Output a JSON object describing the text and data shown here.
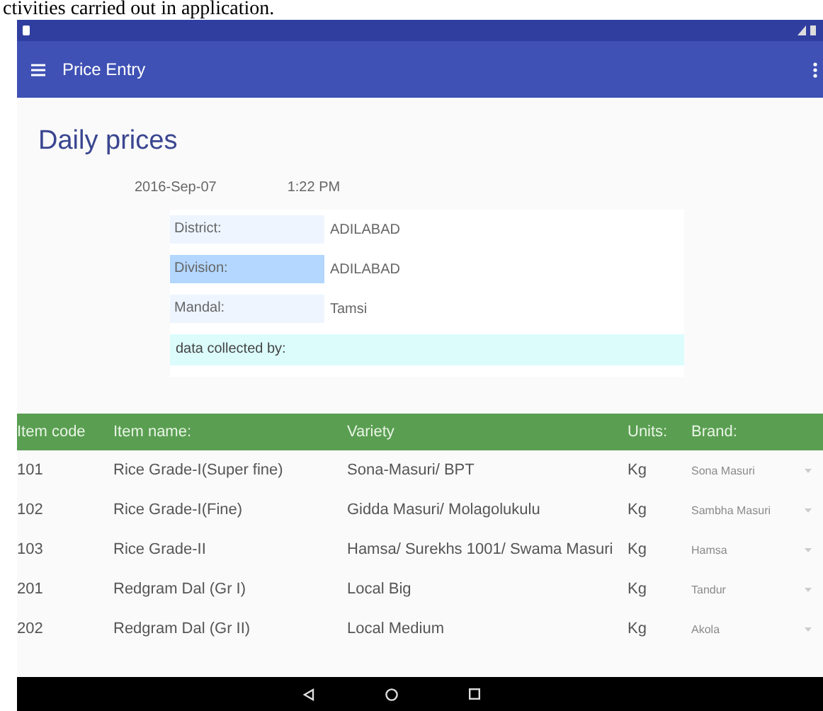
{
  "caption": "ctivities carried out in application.",
  "app_bar": {
    "title": "Price Entry"
  },
  "heading": "Daily prices",
  "date": "2016-Sep-07",
  "time": "1:22 PM",
  "form": [
    {
      "label": "District:",
      "value": "ADILABAD",
      "selected": false
    },
    {
      "label": "Division:",
      "value": "ADILABAD",
      "selected": true
    },
    {
      "label": "Mandal:",
      "value": "Tamsi",
      "selected": false
    }
  ],
  "collected_by": {
    "label": "data collected by:"
  },
  "table": {
    "columns": [
      "Item code",
      "Item name:",
      "Variety",
      "Units:",
      "Brand:"
    ],
    "rows": [
      {
        "code": "101",
        "name": "Rice Grade-I(Super fine)",
        "variety": "Sona-Masuri/ BPT",
        "units": "Kg",
        "brand_placeholder": "Sona Masuri"
      },
      {
        "code": "102",
        "name": "Rice Grade-I(Fine)",
        "variety": "Gidda Masuri/ Molagolukulu",
        "units": "Kg",
        "brand_placeholder": "Sambha Masuri"
      },
      {
        "code": "103",
        "name": "Rice Grade-II",
        "variety": "Hamsa/ Surekhs 1001/ Swama Masuri",
        "units": "Kg",
        "brand_placeholder": "Hamsa"
      },
      {
        "code": "201",
        "name": "Redgram Dal (Gr I)",
        "variety": "Local Big",
        "units": "Kg",
        "brand_placeholder": "Tandur"
      },
      {
        "code": "202",
        "name": "Redgram Dal (Gr II)",
        "variety": "Local Medium",
        "units": "Kg",
        "brand_placeholder": "Akola"
      }
    ]
  }
}
